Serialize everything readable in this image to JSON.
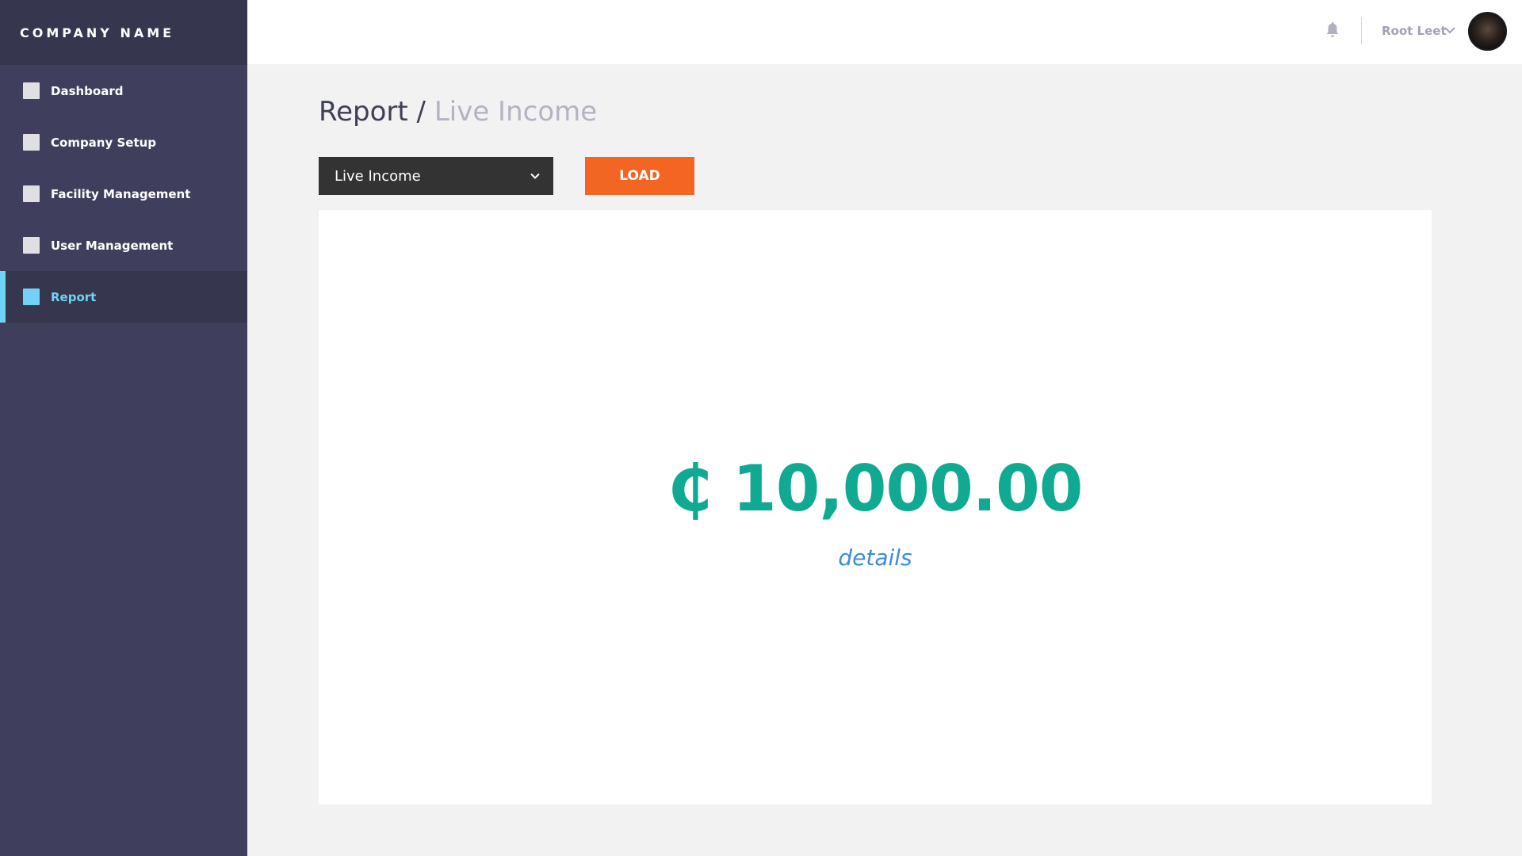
{
  "sidebar": {
    "brand": "COMPANY NAME",
    "items": [
      {
        "label": "Dashboard"
      },
      {
        "label": "Company Setup"
      },
      {
        "label": "Facility Management"
      },
      {
        "label": "User Management"
      },
      {
        "label": "Report"
      }
    ],
    "active_index": 4
  },
  "topbar": {
    "user_name": "Root Leet",
    "icons": [
      "bell-icon",
      "chevron-down-icon",
      "avatar"
    ]
  },
  "main": {
    "breadcrumb": {
      "root": "Report",
      "separator": "/",
      "current": "Live Income"
    },
    "report_select": {
      "selected": "Live Income"
    },
    "load_label": "LOAD",
    "card": {
      "amount": "₵ 10,000.00",
      "details_label": "details"
    }
  },
  "colors": {
    "sidebar_bg": "#3f3f5d",
    "active_accent": "#6fd3f5",
    "load_button": "#f26522",
    "amount": "#10a991",
    "link": "#3d8bda"
  }
}
